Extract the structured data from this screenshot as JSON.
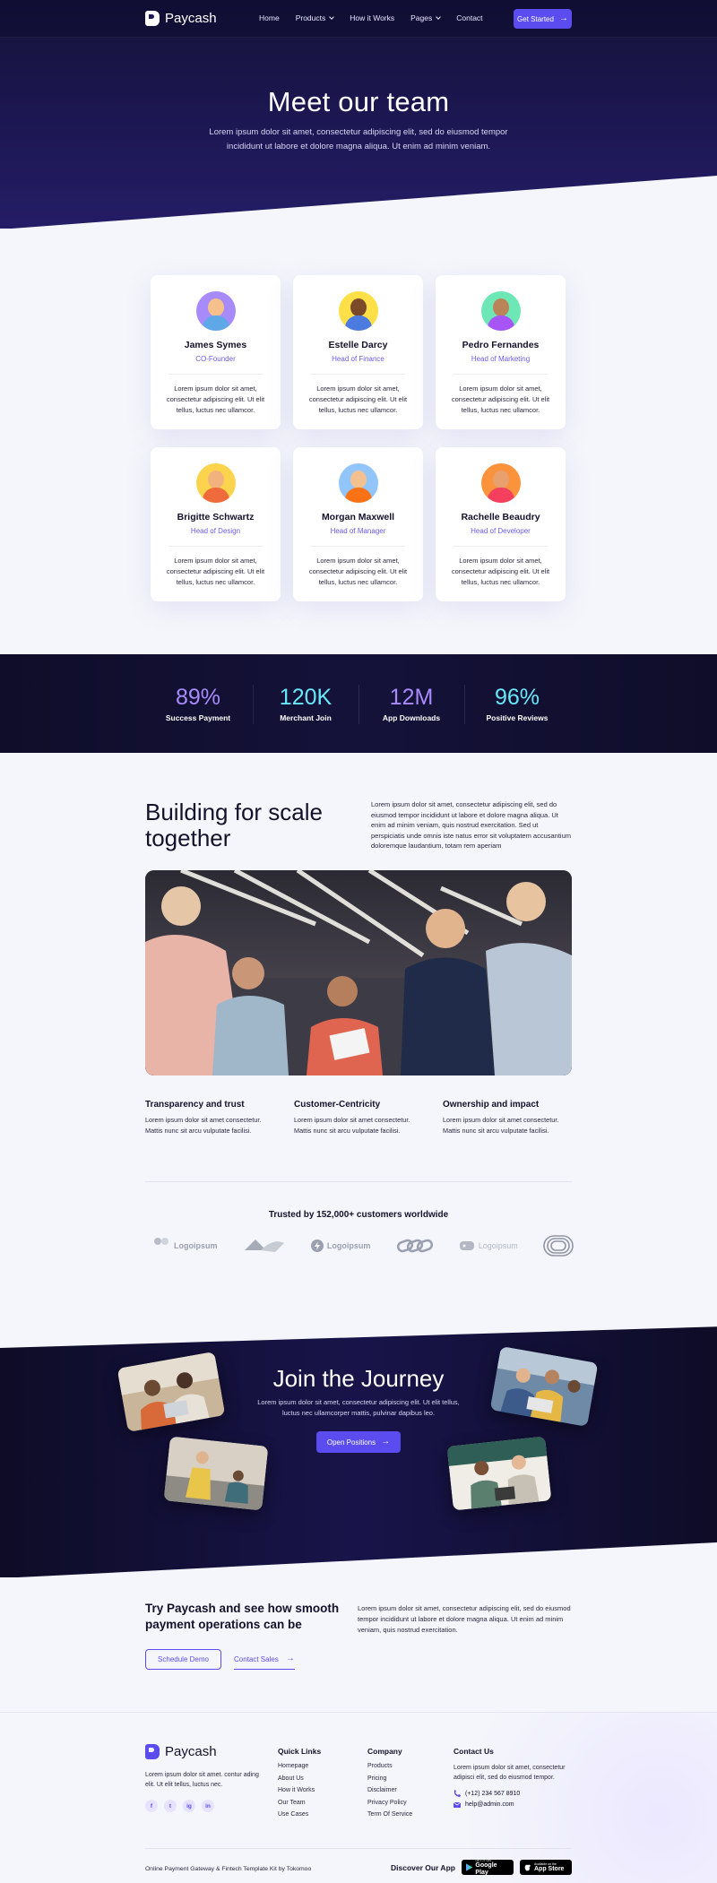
{
  "brand": {
    "name": "Paycash"
  },
  "nav": {
    "items": [
      {
        "label": "Home",
        "dropdown": false
      },
      {
        "label": "Products",
        "dropdown": true
      },
      {
        "label": "How it Works",
        "dropdown": false
      },
      {
        "label": "Pages",
        "dropdown": true
      },
      {
        "label": "Contact",
        "dropdown": false
      }
    ],
    "cta": "Get Started"
  },
  "hero": {
    "title": "Meet our team",
    "subtitle": "Lorem ipsum dolor sit amet, consectetur adipiscing elit, sed do eiusmod tempor incididunt ut labore et dolore magna aliqua. Ut enim ad minim veniam."
  },
  "team": {
    "members": [
      {
        "name": "James Symes",
        "role": "CO-Founder",
        "bio": "Lorem ipsum dolor sit amet, consectetur adipiscing elit. Ut elit tellus, luctus nec ullamcor.",
        "avatar_bg": "#a78bfa",
        "skin": "#f6c08c",
        "shirt": "#5fa8e8"
      },
      {
        "name": "Estelle Darcy",
        "role": "Head of Finance",
        "bio": "Lorem ipsum dolor sit amet, consectetur adipiscing elit. Ut elit tellus, luctus nec ullamcor.",
        "avatar_bg": "#fde047",
        "skin": "#7a4a2a",
        "shirt": "#4c7be0"
      },
      {
        "name": "Pedro Fernandes",
        "role": "Head of Marketing",
        "bio": "Lorem ipsum dolor sit amet, consectetur adipiscing elit. Ut elit tellus, luctus nec ullamcor.",
        "avatar_bg": "#6ee7b7",
        "skin": "#b98457",
        "shirt": "#a855f7"
      },
      {
        "name": "Brigitte Schwartz",
        "role": "Head of Design",
        "bio": "Lorem ipsum dolor sit amet, consectetur adipiscing elit. Ut elit tellus, luctus nec ullamcor.",
        "avatar_bg": "#fcd34d",
        "skin": "#f2b27e",
        "shirt": "#ef6b3b"
      },
      {
        "name": "Morgan Maxwell",
        "role": "Head of Manager",
        "bio": "Lorem ipsum dolor sit amet, consectetur adipiscing elit. Ut elit tellus, luctus nec ullamcor.",
        "avatar_bg": "#93c5fd",
        "skin": "#f3c08f",
        "shirt": "#f97316"
      },
      {
        "name": "Rachelle Beaudry",
        "role": "Head of Developer",
        "bio": "Lorem ipsum dolor sit amet, consectetur adipiscing elit. Ut elit tellus, luctus nec ullamcor.",
        "avatar_bg": "#fb923c",
        "skin": "#e8a06f",
        "shirt": "#f43f5e"
      }
    ]
  },
  "stats": [
    {
      "value": "89%",
      "label": "Success Payment",
      "color": "#a78bfa"
    },
    {
      "value": "120K",
      "label": "Merchant Join",
      "color": "#67e8f9"
    },
    {
      "value": "12M",
      "label": "App Downloads",
      "color": "#a78bfa"
    },
    {
      "value": "96%",
      "label": "Positive Reviews",
      "color": "#67e8f9"
    }
  ],
  "scale": {
    "title": "Building for scale together",
    "text": "Lorem ipsum dolor sit amet, consectetur adipiscing elit, sed do eiusmod tempor incididunt ut labore et dolore magna aliqua. Ut enim ad minim veniam, quis nostrud exercitation. Sed ut perspiciatis unde omnis iste natus error sit voluptatem accusantium doloremque laudantium, totam rem aperiam",
    "values": [
      {
        "title": "Transparency and trust",
        "text": "Lorem ipsum dolor sit amet consectetur. Mattis nunc sit arcu vulputate facilisi."
      },
      {
        "title": "Customer-Centricity",
        "text": "Lorem ipsum dolor sit amet consectetur. Mattis nunc sit arcu vulputate facilisi."
      },
      {
        "title": "Ownership and impact",
        "text": "Lorem ipsum dolor sit amet consectetur. Mattis nunc sit arcu vulputate facilisi."
      }
    ]
  },
  "trusted": {
    "title": "Trusted by 152,000+ customers worldwide",
    "logos": [
      "Logoipsum",
      "Logoipsum",
      "Logoipsum"
    ]
  },
  "join": {
    "title": "Join the Journey",
    "text": "Lorem ipsum dolor sit amet, consectetur adipiscing elit. Ut elit tellus, luctus nec ullamcorper mattis, pulvinar dapibus leo.",
    "cta": "Open Positions"
  },
  "try": {
    "title": "Try Paycash and see how smooth payment operations can be",
    "text": "Lorem ipsum dolor sit amet, consectetur adipiscing elit, sed do eiusmod tempor incididunt ut labore et dolore magna aliqua. Ut enim ad minim veniam, quis nostrud exercitation.",
    "primary": "Schedule Demo",
    "secondary": "Contact Sales"
  },
  "footer": {
    "about": "Lorem ipsum dolor sit amet. contur ading elit. Ut elit tellus, luctus nec.",
    "socials": [
      "f",
      "t",
      "ig",
      "in"
    ],
    "quick_links": {
      "title": "Quick Links",
      "items": [
        "Homepage",
        "About Us",
        "How it Works",
        "Our Team",
        "Use Cases"
      ]
    },
    "company": {
      "title": "Company",
      "items": [
        "Products",
        "Pricing",
        "Disclaimer",
        "Privacy Policy",
        "Term Of Service"
      ]
    },
    "contact": {
      "title": "Contact Us",
      "text": "Lorem ipsum dolor sit amet, consectetur adipisci elit, sed do eiusmod tempor.",
      "phone": "(+12) 234 567 8910",
      "email": "help@admin.com"
    },
    "copyright": "Online Payment Gateway & Fintech Template Kit by Tokomoo",
    "discover": "Discover Our App",
    "google_play": {
      "small": "GET IT ON",
      "big": "Google Play"
    },
    "app_store": {
      "small": "Available on the",
      "big": "App Store"
    }
  }
}
